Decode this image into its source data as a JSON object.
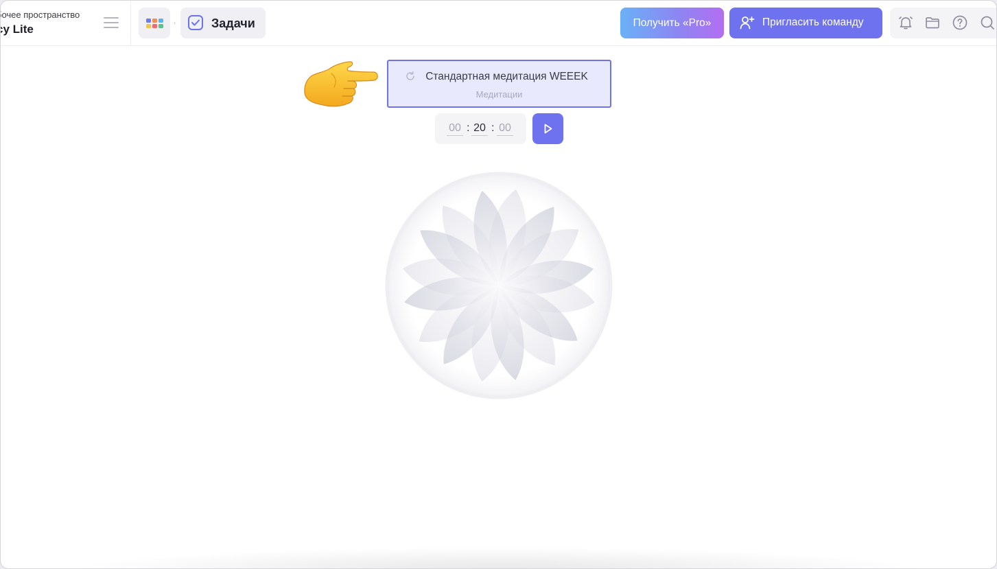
{
  "workspace": {
    "caption": "бочее пространство",
    "name": "cy Lite"
  },
  "breadcrumb": {
    "separator": "›",
    "current": "Задачи"
  },
  "header": {
    "pro_label": "Получить «Pro»",
    "invite_label": "Пригласить команду"
  },
  "meditation": {
    "title": "Стандартная медитация WEEEK",
    "category": "Медитации"
  },
  "timer": {
    "hours": "00",
    "minutes": "20",
    "seconds": "00",
    "separator": ":"
  },
  "icons": {
    "apps": "apps-grid-icon",
    "tasks": "checkbox-icon",
    "invite": "add-user-icon",
    "notifications": "bell-icon",
    "files": "folder-icon",
    "help": "question-icon",
    "search": "search-icon",
    "pointer": "pointing-hand-emoji",
    "play": "play-icon",
    "refresh": "refresh-icon"
  },
  "colors": {
    "accent": "#6f72ee",
    "card_bg": "#e8e9fc",
    "pro_gradient_start": "#6ab1f7",
    "pro_gradient_end": "#b36ef2"
  }
}
